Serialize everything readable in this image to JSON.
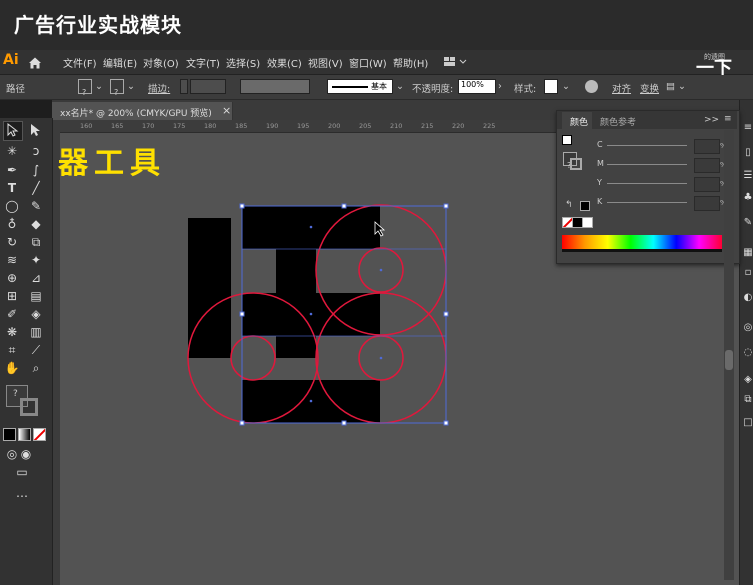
{
  "video_title": "广告行业实战模块",
  "overlay_text": "器工具",
  "next_overlay": "一下",
  "next_overlay_sub": "的遗图",
  "app": {
    "logo": "Ai",
    "menu": [
      "文件(F)",
      "编辑(E)",
      "对象(O)",
      "文字(T)",
      "选择(S)",
      "效果(C)",
      "视图(V)",
      "窗口(W)",
      "帮助(H)"
    ]
  },
  "control_bar": {
    "selection_label": "路径",
    "stroke_label": "描边:",
    "stroke_style": "基本",
    "opacity_label": "不透明度:",
    "opacity_value": "100%",
    "style_label": "样式:",
    "align_label": "对齐",
    "transform_label": "变换"
  },
  "document_tab": {
    "title": "xx名片* @ 200% (CMYK/GPU 预览)",
    "close": "×"
  },
  "ruler": {
    "ticks": [
      "160",
      "165",
      "170",
      "175",
      "180",
      "185",
      "190",
      "195",
      "200",
      "205",
      "210",
      "215",
      "220",
      "225"
    ]
  },
  "color_panel": {
    "tabs": [
      "颜色",
      "颜色参考"
    ],
    "channels": [
      "C",
      "M",
      "Y",
      "K"
    ],
    "unit": "%",
    "menu_icon": "≡",
    "collapse_icon": ">>"
  },
  "colors": {
    "accent_overlay": "#ffe000",
    "guide_red": "#e0183c",
    "bounding_box": "#4f6bd8",
    "canvas": "#535353"
  }
}
